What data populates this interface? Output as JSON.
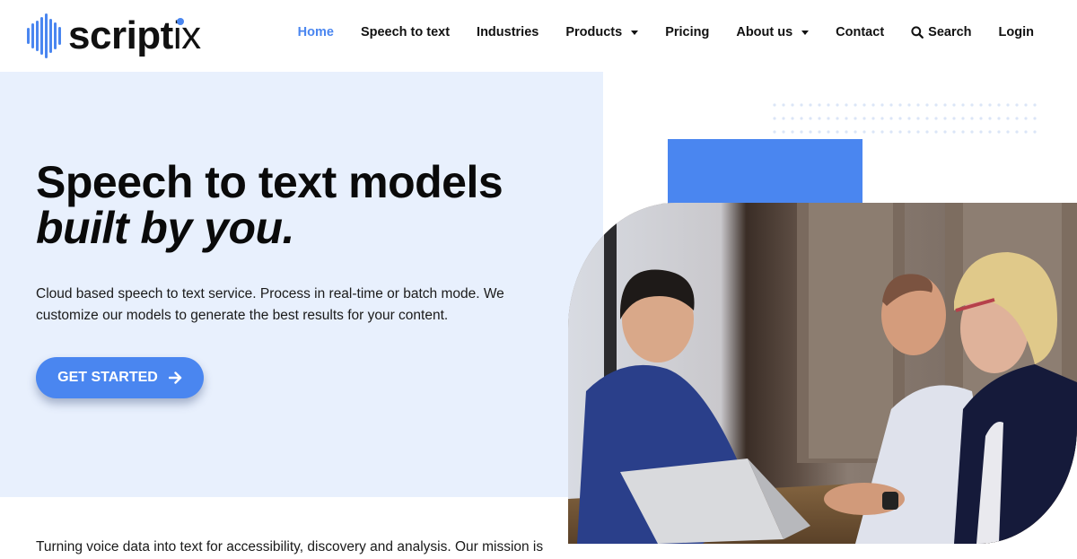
{
  "brand": {
    "name_bold": "script",
    "name_light": "ix",
    "accent_color": "#4a86f0",
    "hero_bg_color": "#e8f0fd"
  },
  "nav": {
    "items": [
      {
        "label": "Home",
        "active": true,
        "dropdown": false
      },
      {
        "label": "Speech to text",
        "active": false,
        "dropdown": false
      },
      {
        "label": "Industries",
        "active": false,
        "dropdown": false
      },
      {
        "label": "Products",
        "active": false,
        "dropdown": true
      },
      {
        "label": "Pricing",
        "active": false,
        "dropdown": false
      },
      {
        "label": "About us",
        "active": false,
        "dropdown": true
      },
      {
        "label": "Contact",
        "active": false,
        "dropdown": false
      },
      {
        "label": "Search",
        "active": false,
        "dropdown": false,
        "icon": "search-icon"
      },
      {
        "label": "Login",
        "active": false,
        "dropdown": false
      }
    ]
  },
  "hero": {
    "title_line1": "Speech to text models",
    "title_line2": "built by you.",
    "description": "Cloud based speech to text service. Process in real-time or batch mode. We customize our models to generate the best results for your content.",
    "cta_label": "GET STARTED",
    "cta_icon": "arrow-right-icon",
    "image_alt": "Three colleagues looking at a laptop at a wooden table"
  },
  "mission": {
    "text": "Turning voice data into text for accessibility, discovery and analysis. Our mission is"
  }
}
